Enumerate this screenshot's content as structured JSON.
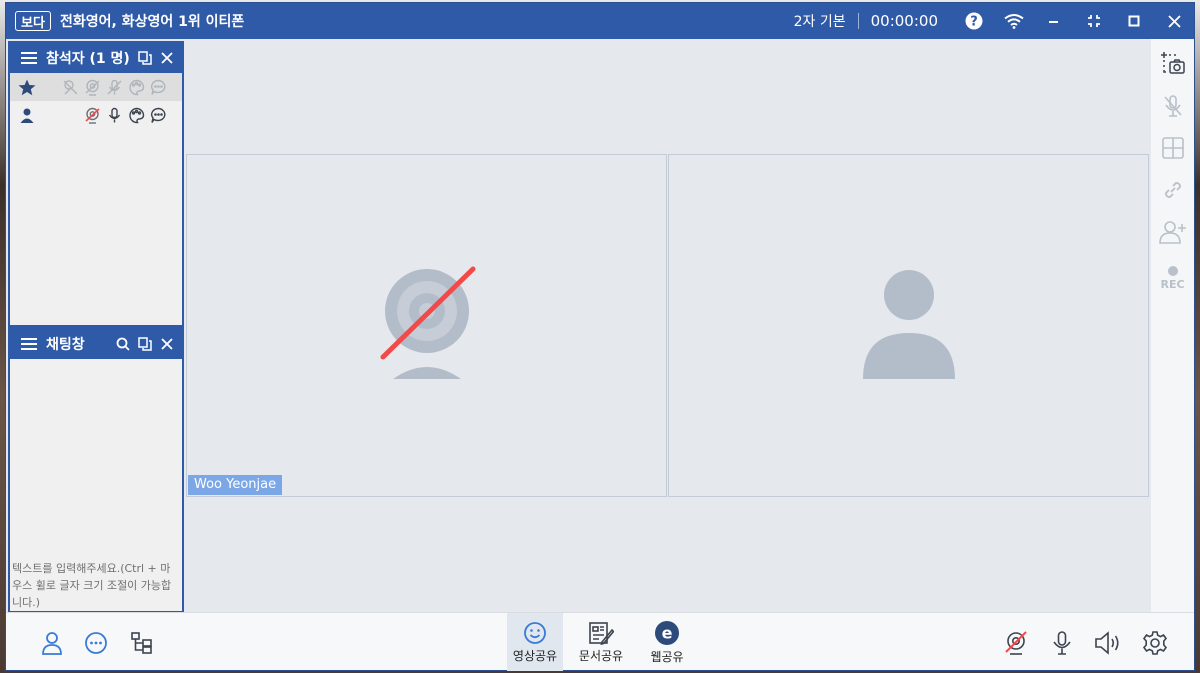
{
  "app": {
    "logo": "보다",
    "title": "전화영어, 화상영어 1위 이티폰",
    "mode": "2자 기본",
    "timer": "00:00:00"
  },
  "participants": {
    "title": "참석자 (1 명)"
  },
  "chat": {
    "title": "채팅창",
    "placeholder": "텍스트를 입력해주세요.(Ctrl + 마우스 휠로 글자 크기 조절이 가능합니다.)"
  },
  "video": {
    "local_name": "Woo Yeonjae"
  },
  "sidebar": {
    "rec_label": "REC"
  },
  "bottom": {
    "share_video": "영상공유",
    "share_doc": "문서공유",
    "share_web": "웹공유"
  },
  "colors": {
    "primary": "#2f5aa7",
    "accent_icon": "#3a7bd5",
    "disabled": "#b8c0ca",
    "off_red": "#f24949",
    "name_tag": "#7ba7e6"
  },
  "icons": {
    "help": "question-icon",
    "network": "wifi-icon",
    "minimize": "minimize-icon",
    "fullscreen": "fullscreen-icon",
    "maximize": "maximize-icon",
    "close": "close-icon"
  }
}
